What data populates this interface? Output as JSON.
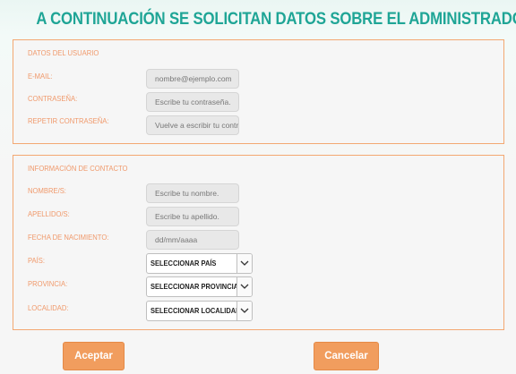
{
  "page": {
    "title": "A CONTINUACIÓN SE SOLICITAN DATOS SOBRE EL ADMINISTRADOR"
  },
  "user_section": {
    "legend": "DATOS DEL USUARIO",
    "fields": [
      {
        "label": "E-MAIL:",
        "placeholder": "nombre@ejemplo.com",
        "value": ""
      },
      {
        "label": "CONTRASEÑA:",
        "placeholder": "Escribe tu contraseña.",
        "value": ""
      },
      {
        "label": "REPETIR CONTRASEÑA:",
        "placeholder": "Vuelve a escribir tu contraseña.",
        "value": ""
      }
    ]
  },
  "contact_section": {
    "legend": "INFORMACIÓN DE CONTACTO",
    "fields": [
      {
        "label": "NOMBRE/S:",
        "placeholder": "Escribe tu nombre.",
        "value": ""
      },
      {
        "label": "APELLIDO/S:",
        "placeholder": "Escribe tu apellido.",
        "value": ""
      },
      {
        "label": "FECHA DE NACIMIENTO:",
        "placeholder": "dd/mm/aaaa",
        "value": ""
      }
    ],
    "selects": [
      {
        "label": "PAÍS:",
        "selected": "SELECCIONAR PAÍS"
      },
      {
        "label": "PROVINCIA:",
        "selected": "SELECCIONAR PROVINCIA"
      },
      {
        "label": "LOCALIDAD:",
        "selected": "SELECCIONAR LOCALIDAD"
      }
    ]
  },
  "buttons": {
    "accept_label": "Aceptar",
    "cancel_label": "Cancelar"
  },
  "colors": {
    "title": "#1fa596",
    "accent": "#f19d5e",
    "label": "#f0996b",
    "border": "#f3a872"
  },
  "icons": {
    "select_arrow": "chevron-down-icon"
  }
}
